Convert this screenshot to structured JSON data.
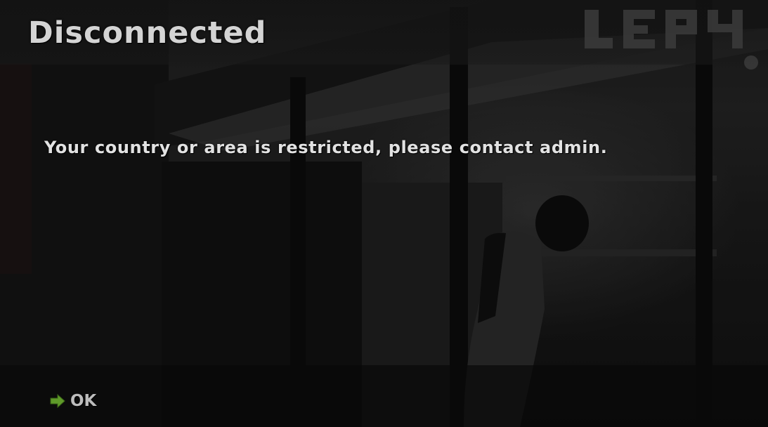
{
  "dialog": {
    "title": "Disconnected",
    "message": "Your country or area is restricted, please contact admin.",
    "ok_label": "OK"
  },
  "icons": {
    "ok": "arrow-right-icon"
  },
  "colors": {
    "title_text": "#d4d4d4",
    "message_text": "#e2e2e2",
    "ok_text": "#bdbdbd",
    "ok_arrow": "#5f9a2a"
  }
}
